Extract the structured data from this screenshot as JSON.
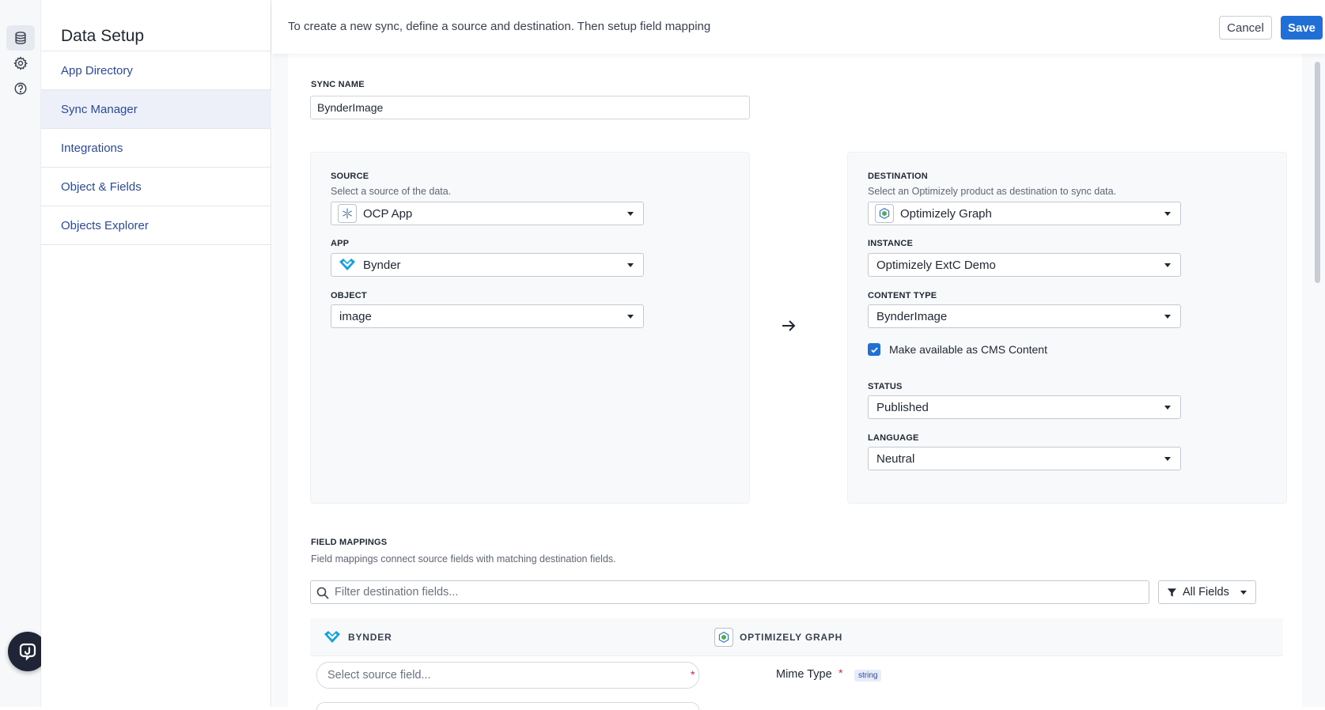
{
  "nav": {
    "title": "Data Setup",
    "items": [
      {
        "label": "App Directory",
        "active": false
      },
      {
        "label": "Sync Manager",
        "active": true
      },
      {
        "label": "Integrations",
        "active": false
      },
      {
        "label": "Object & Fields",
        "active": false
      },
      {
        "label": "Objects Explorer",
        "active": false
      }
    ]
  },
  "rail": {
    "icons": [
      "database-icon",
      "gear-icon",
      "help-icon"
    ]
  },
  "header": {
    "instruction": "To create a new sync, define a source and destination. Then setup field mapping",
    "cancel_label": "Cancel",
    "save_label": "Save"
  },
  "sync_name": {
    "label": "SYNC NAME",
    "value": "BynderImage"
  },
  "source": {
    "label": "SOURCE",
    "help": "Select a source of the data.",
    "value": "OCP App",
    "app": {
      "label": "APP",
      "value": "Bynder"
    },
    "object": {
      "label": "OBJECT",
      "value": "image"
    }
  },
  "destination": {
    "label": "DESTINATION",
    "help": "Select an Optimizely product as destination to sync data.",
    "value": "Optimizely Graph",
    "instance": {
      "label": "INSTANCE",
      "value": "Optimizely ExtC Demo"
    },
    "content_type": {
      "label": "CONTENT TYPE",
      "value": "BynderImage"
    },
    "cms_checkbox": {
      "label": "Make available as CMS Content",
      "checked": true
    },
    "status": {
      "label": "STATUS",
      "value": "Published"
    },
    "language": {
      "label": "LANGUAGE",
      "value": "Neutral"
    }
  },
  "field_mappings": {
    "label": "FIELD MAPPINGS",
    "help": "Field mappings connect source fields with matching destination fields.",
    "filter_placeholder": "Filter destination fields...",
    "filter_button": "All Fields",
    "source_column": "BYNDER",
    "destination_column": "OPTIMIZELY GRAPH",
    "rows": [
      {
        "source_placeholder": "Select source field...",
        "required_mark": "*",
        "destination_field": "Mime Type",
        "type": "string"
      }
    ]
  },
  "colors": {
    "accent": "#1f6fd6",
    "link": "#2b4a9a",
    "required": "#d7263d"
  }
}
